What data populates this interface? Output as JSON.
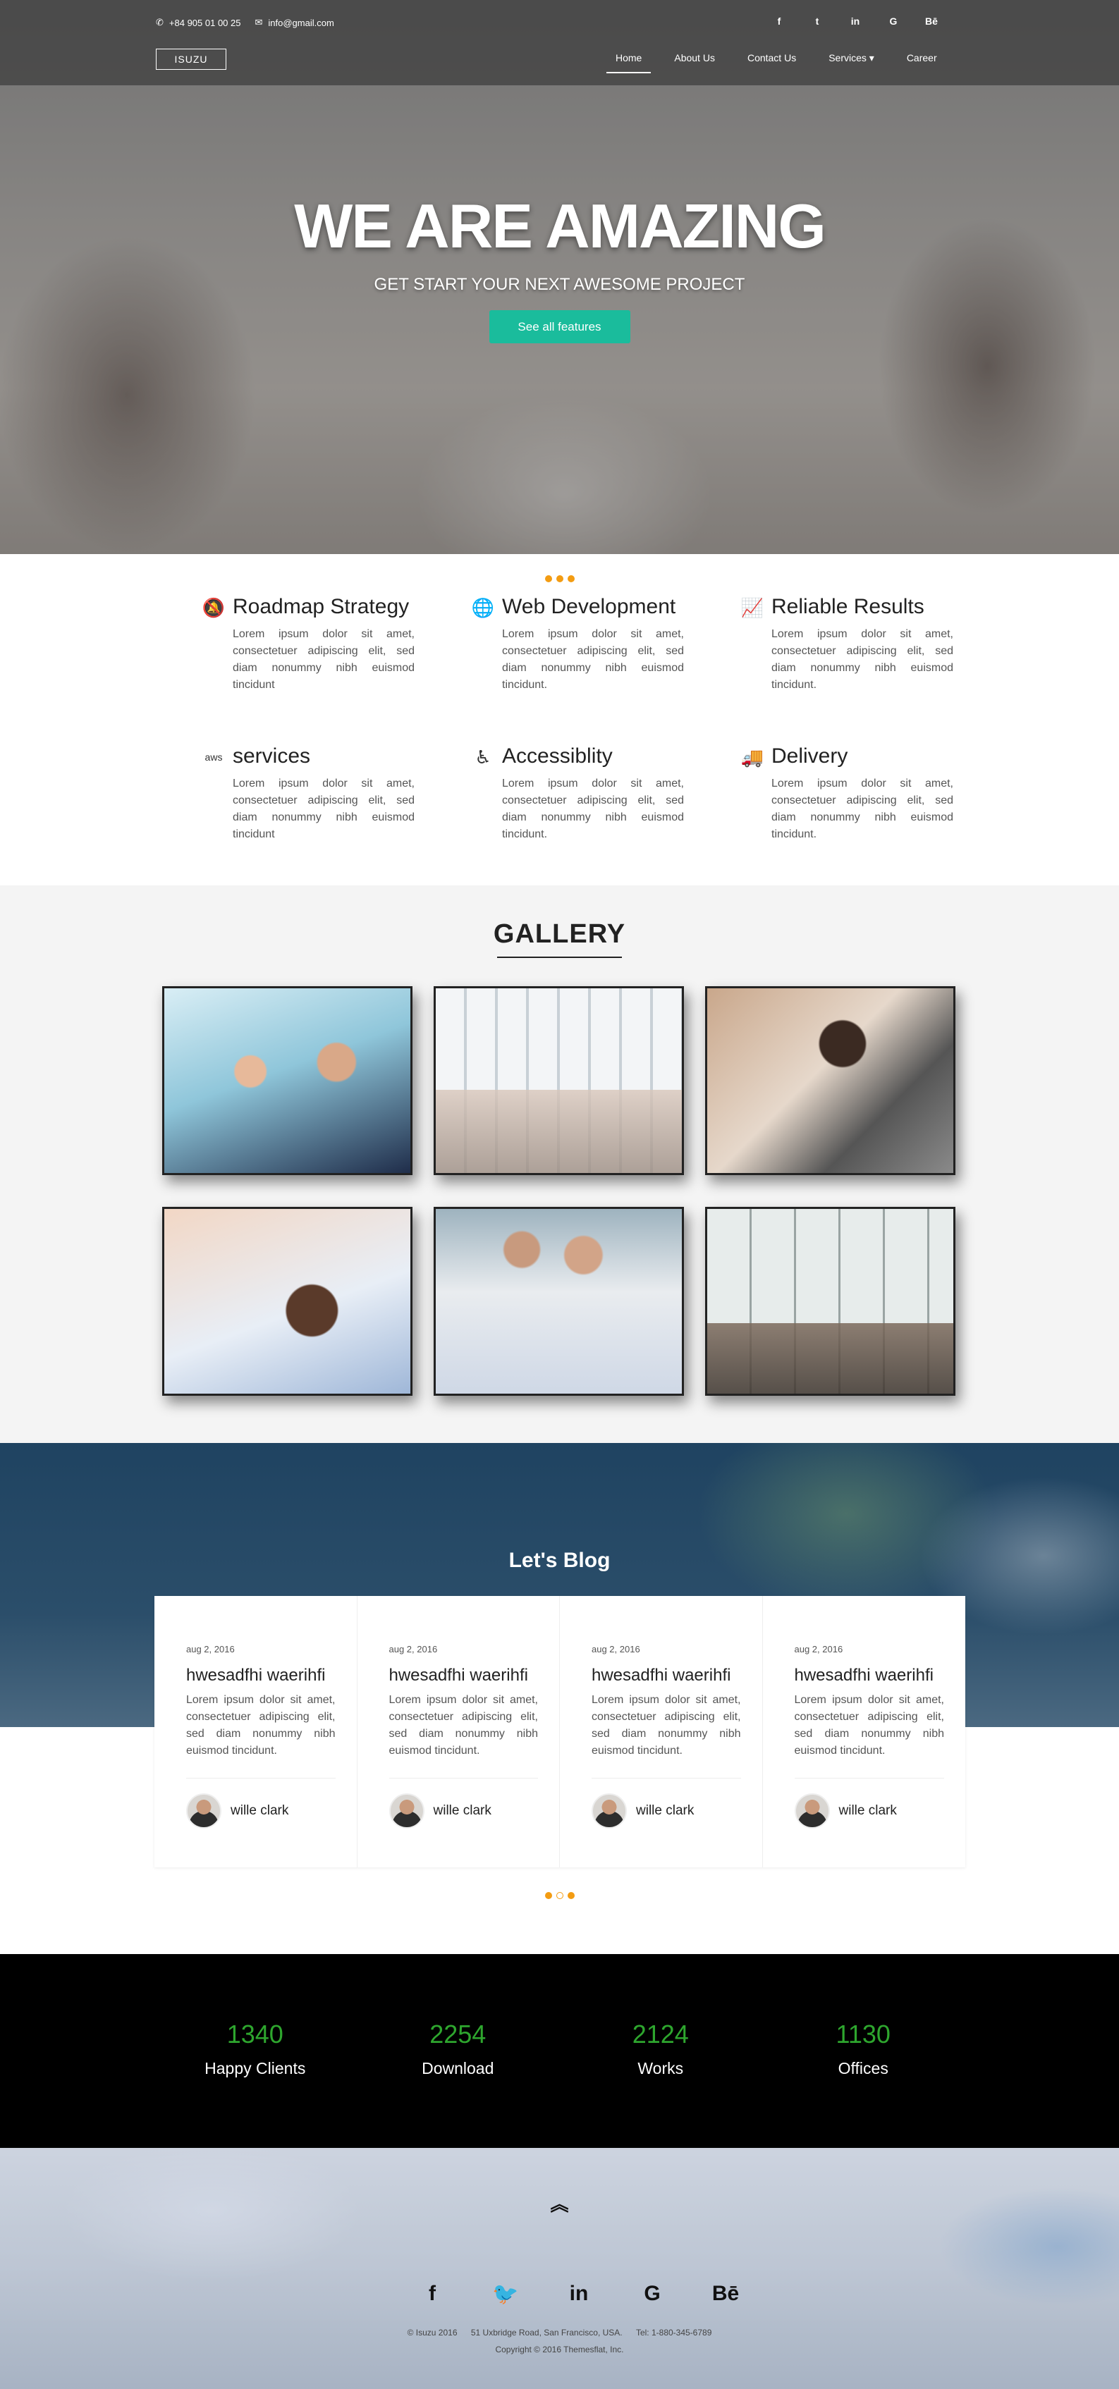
{
  "header": {
    "phone": "+84 905 01 00 25",
    "email": "info@gmail.com",
    "logo": "ISUZU",
    "socials": [
      "f",
      "t",
      "in",
      "G",
      "Bē"
    ],
    "nav": [
      "Home",
      "About Us",
      "Contact Us",
      "Services ▾",
      "Career"
    ]
  },
  "hero": {
    "title": "WE ARE AMAZING",
    "subtitle": "GET START YOUR NEXT AWESOME PROJECT",
    "button": "See all features"
  },
  "features": [
    {
      "icon": "bell-slash-icon",
      "glyph": "🔕",
      "title": "Roadmap Strategy",
      "text": "Lorem ipsum dolor sit amet, consectetuer adipiscing elit, sed diam nonummy nibh euismod tincidunt"
    },
    {
      "icon": "globe-icon",
      "glyph": "🌐",
      "title": "Web Development",
      "text": "Lorem ipsum dolor sit amet, consectetuer adipiscing elit, sed diam nonummy nibh euismod tincidunt."
    },
    {
      "icon": "line-chart-icon",
      "glyph": "📈",
      "title": "Reliable Results",
      "text": "Lorem ipsum dolor sit amet, consectetuer adipiscing elit, sed diam nonummy nibh euismod tincidunt."
    },
    {
      "icon": "aws-icon",
      "glyph": "aws",
      "title": "services",
      "text": "Lorem ipsum dolor sit amet, consectetuer adipiscing elit, sed diam nonummy nibh euismod tincidunt"
    },
    {
      "icon": "accessibility-icon",
      "glyph": "♿",
      "title": "Accessiblity",
      "text": "Lorem ipsum dolor sit amet, consectetuer adipiscing elit, sed diam nonummy nibh euismod tincidunt."
    },
    {
      "icon": "truck-icon",
      "glyph": "🚚",
      "title": "Delivery",
      "text": "Lorem ipsum dolor sit amet, consectetuer adipiscing elit, sed diam nonummy nibh euismod tincidunt."
    }
  ],
  "gallery": {
    "title": "GALLERY"
  },
  "blog": {
    "title": "Let's Blog",
    "cards": [
      {
        "date": "aug 2, 2016",
        "title": "hwesadfhi waerihfi",
        "text": "Lorem ipsum dolor sit amet, consectetuer adipiscing elit, sed diam nonummy nibh euismod tincidunt.",
        "author": "wille clark"
      },
      {
        "date": "aug 2, 2016",
        "title": "hwesadfhi waerihfi",
        "text": "Lorem ipsum dolor sit amet, consectetuer adipiscing elit, sed diam nonummy nibh euismod tincidunt.",
        "author": "wille clark"
      },
      {
        "date": "aug 2, 2016",
        "title": "hwesadfhi waerihfi",
        "text": "Lorem ipsum dolor sit amet, consectetuer adipiscing elit, sed diam nonummy nibh euismod tincidunt.",
        "author": "wille clark"
      },
      {
        "date": "aug 2, 2016",
        "title": "hwesadfhi waerihfi",
        "text": "Lorem ipsum dolor sit amet, consectetuer adipiscing elit, sed diam nonummy nibh euismod tincidunt.",
        "author": "wille clark"
      }
    ]
  },
  "stats": [
    {
      "value": "1340",
      "label": "Happy Clients"
    },
    {
      "value": "2254",
      "label": "Download"
    },
    {
      "value": "2124",
      "label": "Works"
    },
    {
      "value": "1130",
      "label": "Offices"
    }
  ],
  "footer": {
    "to_top": "︽",
    "socials": [
      "f",
      "🐦",
      "in",
      "G",
      "Bē"
    ],
    "company": "© Isuzu 2016",
    "address": "51 Uxbridge Road, San Francisco, USA.",
    "tel": "Tel: 1-880-345-6789",
    "copyright": "Copyright © 2016 Themesflat, Inc."
  },
  "colors": {
    "accent_green": "#1abc9c",
    "stat_green": "#2ea62e",
    "dot_orange": "#f39c12"
  }
}
